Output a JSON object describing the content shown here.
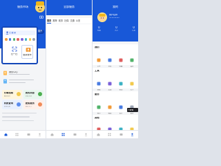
{
  "screen1": {
    "title": "服务市场",
    "login_pill": "已登录",
    "expand_pill": "展开",
    "popup": {
      "login_label": "已登录",
      "button_1_label": "扫一扫",
      "button_2_label": "登录账号"
    },
    "info_title": "我的中心",
    "cards": [
      {
        "label": "办事指南",
        "sub": "最新服务",
        "color": "#fff6dd",
        "orb": "#f2c94c"
      },
      {
        "label": "我的消息",
        "sub": "查看全部",
        "color": "#e8f7ee",
        "orb": "#4caf50"
      },
      {
        "label": "资质查询",
        "sub": "查询记录",
        "color": "#e8f0ff",
        "orb": "#5b8def"
      },
      {
        "label": "便民服务",
        "sub": "服务大厅",
        "color": "#fff0ea",
        "orb": "#f08c5a"
      }
    ],
    "accent": "#1858d8"
  },
  "screen2": {
    "title": "全部服务",
    "tabs": [
      "首页",
      "推荐",
      "政务",
      "社保",
      "交通",
      "公安"
    ],
    "active_tab_index": 0,
    "loading_text": ""
  },
  "screen3": {
    "title": "我的",
    "username": "用户名称",
    "user_sub": "ID:1234567",
    "stats": [
      {
        "value": "0",
        "label": "收藏"
      },
      {
        "value": "0",
        "label": "关注"
      },
      {
        "value": "0",
        "label": "足迹"
      }
    ],
    "sections": [
      {
        "title": "我的",
        "items": [
          "订单",
          "消息",
          "收藏",
          "设置"
        ]
      },
      {
        "title": "工具",
        "items": [
          "客服",
          "反馈",
          "帮助",
          "关于"
        ]
      },
      {
        "title": "服务",
        "items": [
          "预约",
          "缴费",
          "证件",
          "更多"
        ]
      },
      {
        "title": "其他",
        "items": [
          "分享",
          "推荐",
          "评价",
          "版本"
        ]
      }
    ],
    "tooltip": "已收藏"
  }
}
